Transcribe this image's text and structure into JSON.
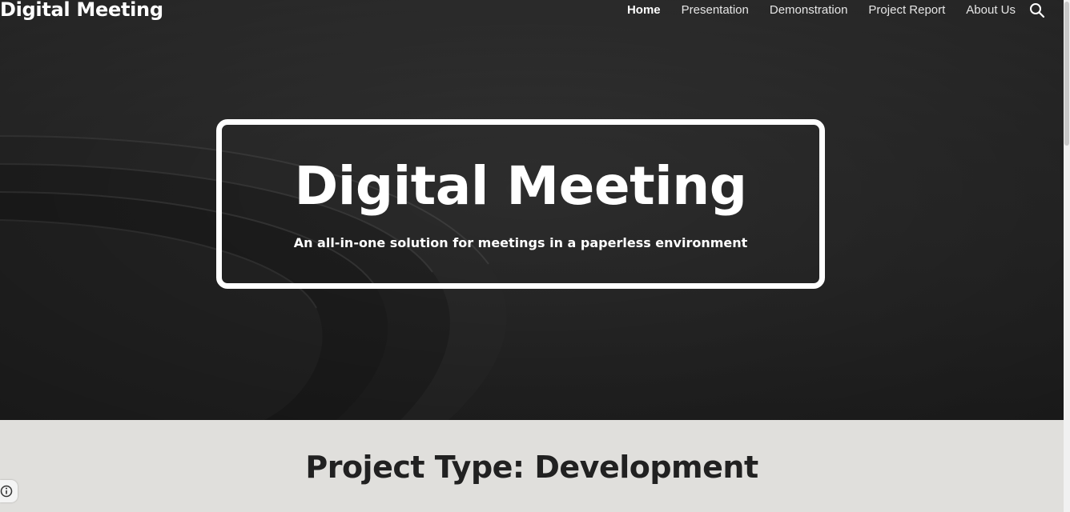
{
  "header": {
    "site_title": "Digital Meeting",
    "nav": [
      {
        "label": "Home",
        "active": true
      },
      {
        "label": "Presentation",
        "active": false
      },
      {
        "label": "Demonstration",
        "active": false
      },
      {
        "label": "Project Report",
        "active": false
      },
      {
        "label": "About Us",
        "active": false
      }
    ],
    "search_icon": "search-icon"
  },
  "hero": {
    "title": "Digital Meeting",
    "subtitle": "An all-in-one solution for meetings in a paperless environment"
  },
  "section": {
    "heading": "Project Type: Development"
  },
  "colors": {
    "hero_bg": "#2e2e2e",
    "section_bg": "#e0dfdc",
    "heading_text": "#212121",
    "hero_text": "#ffffff"
  },
  "info_icon": "info-icon"
}
